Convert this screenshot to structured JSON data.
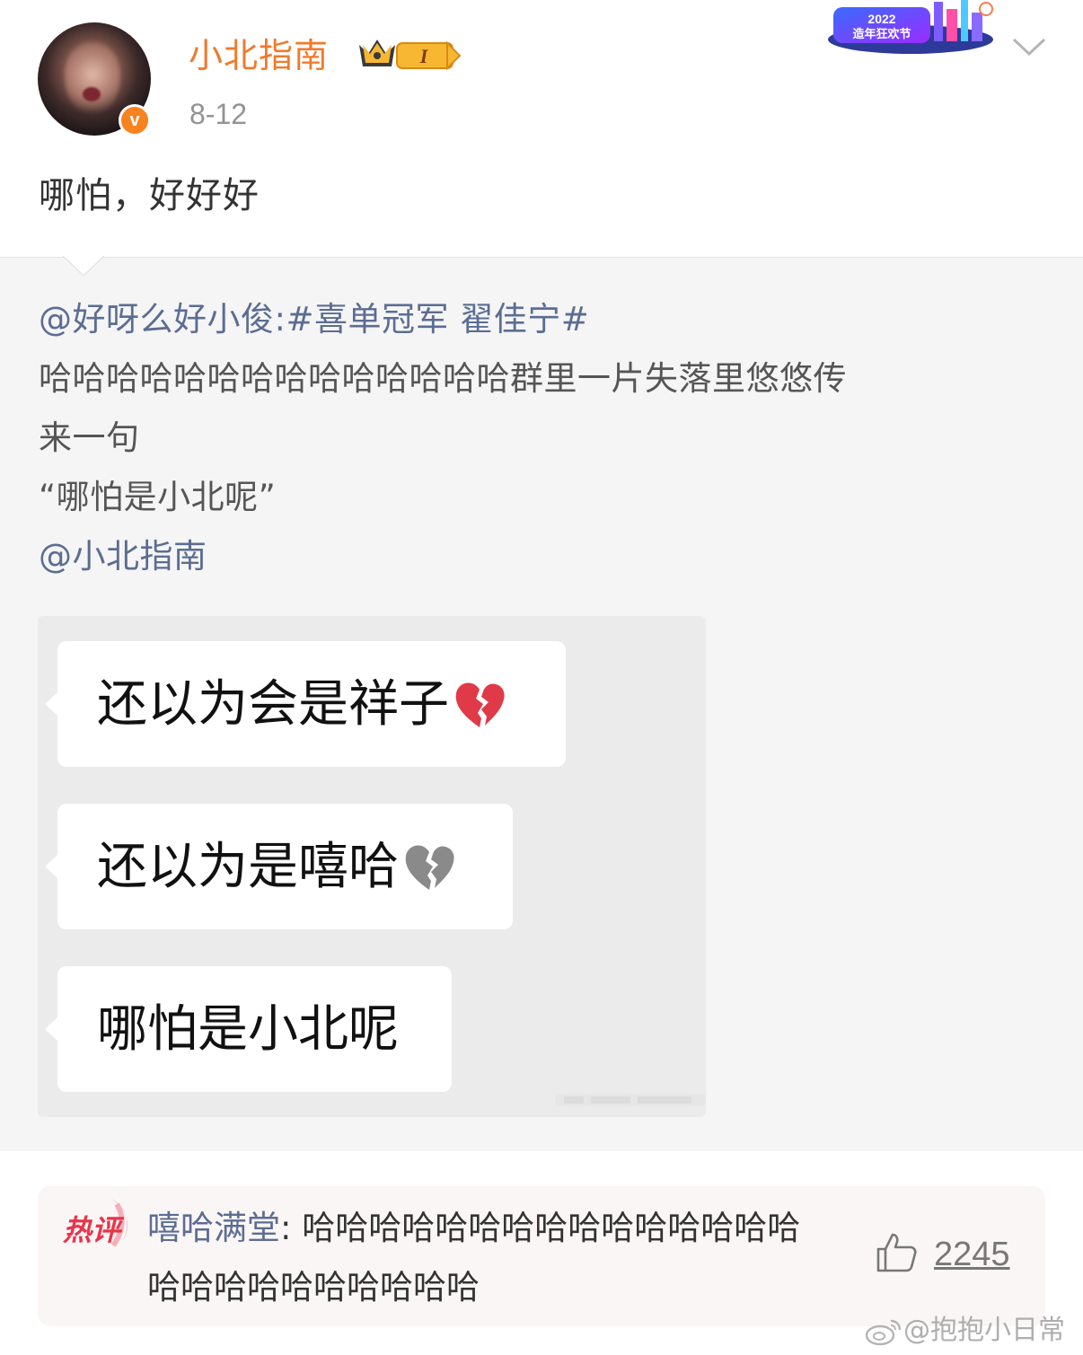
{
  "post": {
    "username": "小北指南",
    "member_level": "I",
    "date": "8-12",
    "verified_mark": "v",
    "text": "哪怕，好好好",
    "festival_badge_text": "2022 · 造年狂欢节"
  },
  "repost": {
    "line1": "@好呀么好小俊:#喜单冠军 翟佳宁#",
    "line2": "哈哈哈哈哈哈哈哈哈哈哈哈哈哈群里一片失落里悠悠传",
    "line3": "来一句",
    "line4": "“哪怕是小北呢”",
    "line5": "@小北指南",
    "chat_messages": [
      {
        "text": "还以为会是祥子",
        "icon": "broken-heart-icon",
        "color": "#e03a48"
      },
      {
        "text": "还以为是嘻哈",
        "icon": "grey-broken-heart-icon",
        "color": "#8a8a8a"
      },
      {
        "text": "哪怕是小北呢"
      }
    ]
  },
  "hot_comment": {
    "label": "热评",
    "author": "嘻哈满堂",
    "separator": ": ",
    "text": "哈哈哈哈哈哈哈哈哈哈哈哈哈哈哈哈哈哈哈哈哈哈哈哈哈",
    "likes": "2245"
  },
  "watermark": "@抱抱小日常",
  "colors": {
    "username": "#f07a2b",
    "link": "#5c6d92",
    "verify": "#f7831f",
    "hot_label": "#e8344a"
  }
}
